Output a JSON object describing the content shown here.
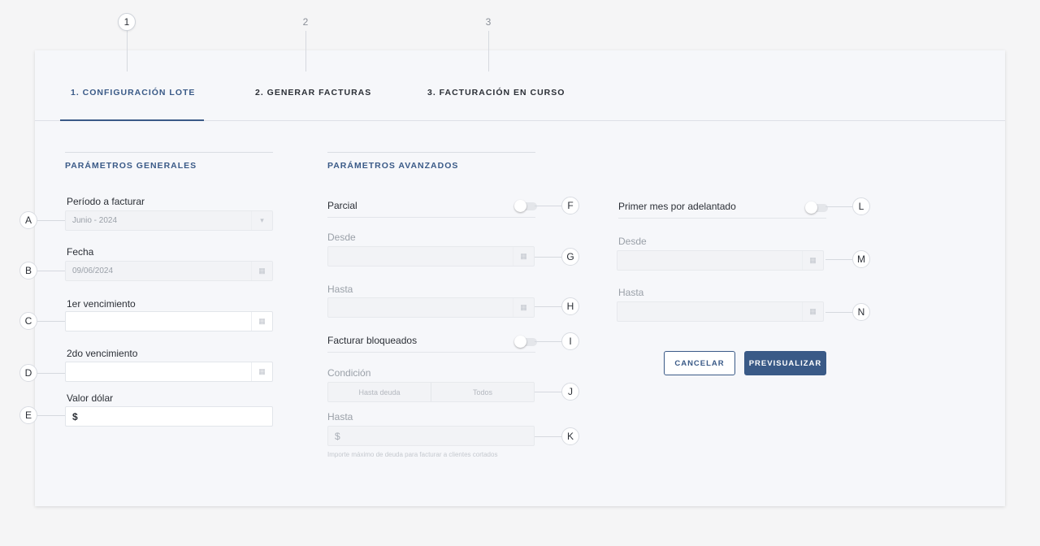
{
  "steps": [
    "1",
    "2",
    "3"
  ],
  "tabs": [
    {
      "label": "1. CONFIGURACIÓN LOTE"
    },
    {
      "label": "2. GENERAR FACTURAS"
    },
    {
      "label": "3. FACTURACIÓN EN CURSO"
    }
  ],
  "markers": [
    "A",
    "B",
    "C",
    "D",
    "E",
    "F",
    "G",
    "H",
    "I",
    "J",
    "K",
    "L",
    "M",
    "N"
  ],
  "general": {
    "title": "PARÁMETROS GENERALES",
    "periodo": {
      "label": "Período a facturar",
      "value": "Junio - 2024"
    },
    "fecha": {
      "label": "Fecha",
      "value": "09/06/2024"
    },
    "venc1": {
      "label": "1er vencimiento",
      "value": ""
    },
    "venc2": {
      "label": "2do vencimiento",
      "value": ""
    },
    "dolar": {
      "label": "Valor dólar",
      "prefix": "$"
    }
  },
  "advanced": {
    "title": "PARÁMETROS AVANZADOS",
    "parcial": {
      "label": "Parcial",
      "on": false
    },
    "desde_label": "Desde",
    "hasta_label": "Hasta",
    "bloqueados": {
      "label": "Facturar bloqueados",
      "on": false
    },
    "condicion": {
      "label": "Condición",
      "options": [
        "Hasta deuda",
        "Todos"
      ]
    },
    "hasta_monto": {
      "label": "Hasta",
      "prefix": "$",
      "helper": "Importe máximo de deuda para facturar a clientes cortados"
    },
    "adelantado": {
      "label": "Primer mes por adelantado",
      "on": false
    },
    "desde2_label": "Desde",
    "hasta2_label": "Hasta"
  },
  "actions": {
    "cancel": "CANCELAR",
    "preview": "PREVISUALIZAR"
  },
  "colors": {
    "accent": "#3a5a87",
    "background": "#f5f5f6",
    "card": "#f6f7fa"
  },
  "icons": {
    "dropdown": "chevron-down-icon",
    "calendar": "calendar-icon"
  }
}
